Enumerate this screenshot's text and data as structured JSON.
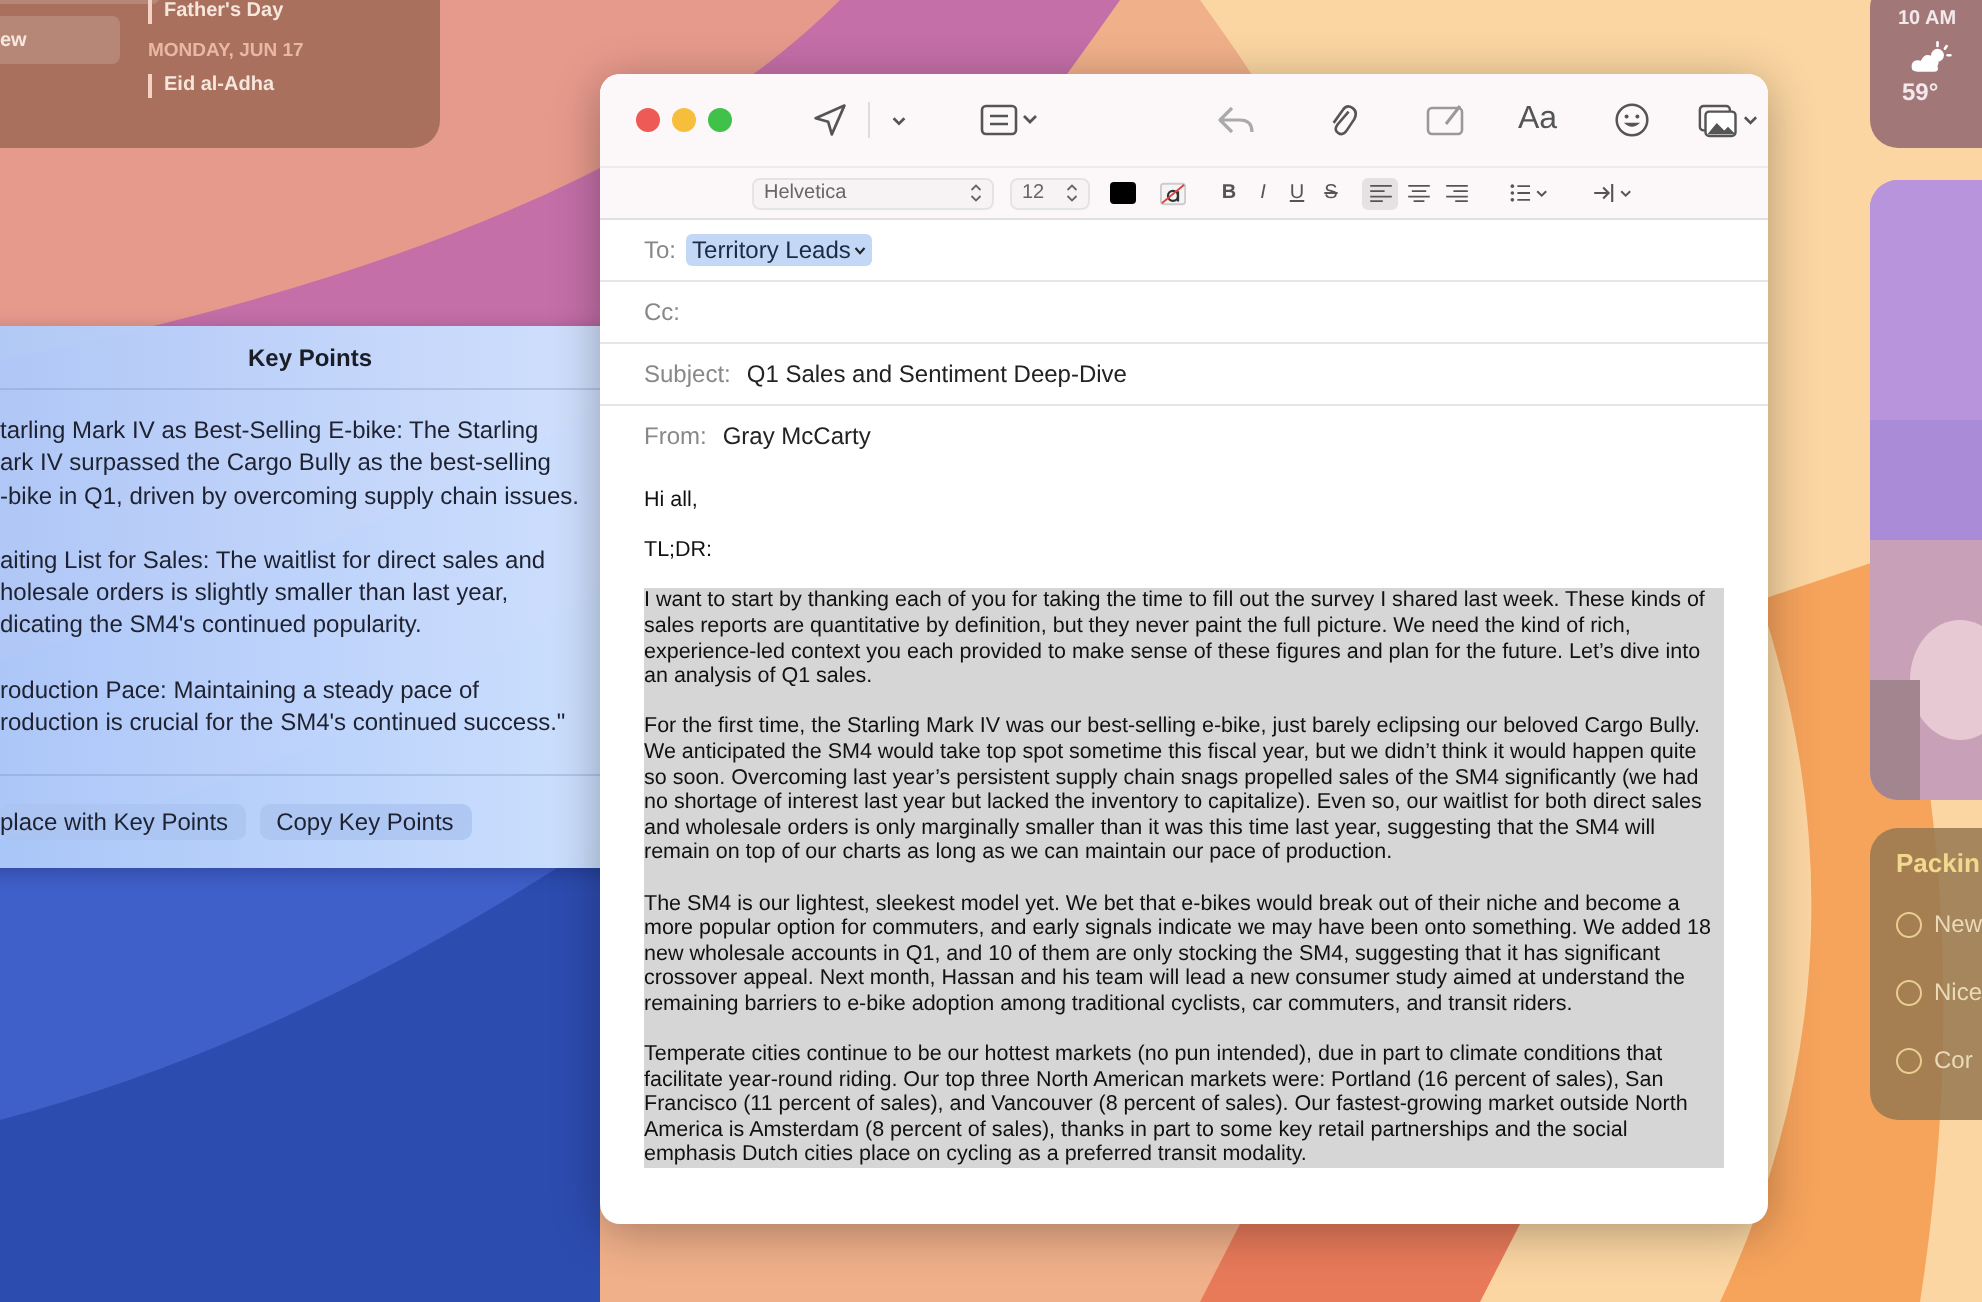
{
  "calendar_widget": {
    "buttons": [
      "ew"
    ],
    "entries": [
      {
        "kind": "event",
        "text": "Father's Day"
      },
      {
        "kind": "date",
        "text": "MONDAY, JUN 17"
      },
      {
        "kind": "event",
        "text": "Eid al-Adha"
      }
    ]
  },
  "weather_widget": {
    "time": "10 AM",
    "temperature": "59°"
  },
  "reminders_widget": {
    "title": "Packin",
    "items": [
      {
        "text": "New",
        "checked": false
      },
      {
        "text": "Nice",
        "checked": false
      },
      {
        "text": "Cor",
        "checked": false
      }
    ]
  },
  "key_points": {
    "title": "Key Points",
    "paragraphs": [
      [
        "tarling Mark IV as Best-Selling E-bike: The Starling",
        "ark IV surpassed the Cargo Bully as the best-selling",
        "-bike in Q1, driven by overcoming supply chain issues."
      ],
      [
        "aiting List for Sales: The waitlist for direct sales and",
        "holesale orders is slightly smaller than last year,",
        "dicating the SM4's continued popularity."
      ],
      [
        "roduction Pace: Maintaining a steady pace of",
        "roduction is crucial for the SM4's continued success.\""
      ]
    ],
    "buttons": [
      "place with Key Points",
      "Copy Key Points"
    ]
  },
  "mail": {
    "toolbar": {
      "text_style_button": "Aa"
    },
    "format_bar": {
      "font": "Helvetica",
      "size": "12",
      "styles": [
        {
          "label": "B",
          "kind": "bold"
        },
        {
          "label": "I",
          "kind": "italic"
        },
        {
          "label": "U",
          "kind": "underline"
        },
        {
          "label": "S",
          "kind": "strike"
        }
      ],
      "alignments": [
        {
          "kind": "left",
          "selected": true
        },
        {
          "kind": "center",
          "selected": false
        },
        {
          "kind": "right",
          "selected": false
        }
      ]
    },
    "headers": [
      {
        "label": "To:",
        "kind": "token",
        "value": "Territory Leads"
      },
      {
        "label": "Cc:",
        "kind": "text"
      },
      {
        "label": "Subject:",
        "kind": "text",
        "value": "Q1 Sales and Sentiment Deep-Dive"
      },
      {
        "label": "From:",
        "kind": "text",
        "value": "Gray McCarty"
      }
    ],
    "greeting": [
      "Hi all,",
      "TL;DR:"
    ],
    "body": {
      "selected": true,
      "paragraphs": [
        "I want to start by thanking each of you for taking the time to fill out the survey I shared last week. These kinds of sales reports are quantitative by definition, but they never paint the full picture. We need the kind of rich, experience-led context you each provided to make sense of these figures and plan for the future. Let’s dive into an analysis of Q1 sales.",
        "For the first time, the Starling Mark IV was our best-selling e-bike, just barely eclipsing our beloved Cargo Bully. We anticipated the SM4 would take top spot sometime this fiscal year, but we didn’t think it would happen quite so soon. Overcoming last year’s persistent supply chain snags propelled sales of the SM4 significantly (we had no shortage of interest last year but lacked the inventory to capitalize). Even so, our waitlist for both direct sales and wholesale orders is only marginally smaller than it was this time last year, suggesting that the SM4 will remain on top of our charts as long as we can maintain our pace of production.",
        "The SM4 is our lightest, sleekest model yet. We bet that e-bikes would break out of their niche and become a more popular option for commuters, and early signals indicate we may have been onto something. We added 18 new wholesale accounts in Q1, and 10 of them are only stocking the SM4, suggesting that it has significant crossover appeal. Next month, Hassan and his team will lead a new consumer study aimed at understand the remaining barriers to e-bike adoption among traditional cyclists, car commuters, and transit riders.",
        "Temperate cities continue to be our hottest markets (no pun intended), due in part to climate conditions that facilitate year-round riding. Our top three North American markets were: Portland (16 percent of sales), San Francisco (11 percent of sales), and Vancouver (8 percent of sales). Our fastest-growing market outside North America is Amsterdam (8 percent of sales), thanks in part to some key retail partnerships and the social emphasis Dutch cities place on cycling as a preferred transit modality."
      ]
    }
  }
}
